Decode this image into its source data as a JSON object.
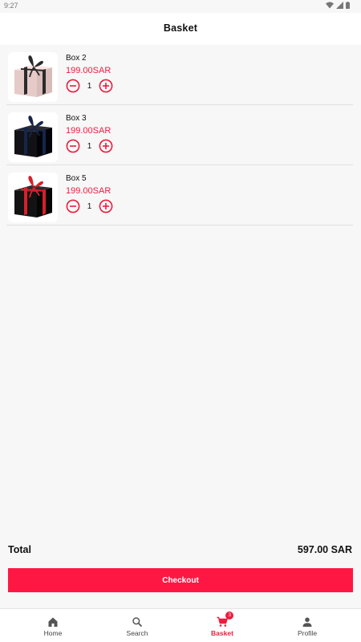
{
  "status_bar": {
    "time": "9:27"
  },
  "header": {
    "title": "Basket"
  },
  "items": [
    {
      "name": "Box 2",
      "price": "199.00SAR",
      "quantity": "1",
      "box_color": "#f1d6d4",
      "ribbon_color": "#2a2a2a"
    },
    {
      "name": "Box 3",
      "price": "199.00SAR",
      "quantity": "1",
      "box_color": "#1e1e22",
      "ribbon_color": "#16254a"
    },
    {
      "name": "Box 5",
      "price": "199.00SAR",
      "quantity": "1",
      "box_color": "#1f1f1f",
      "ribbon_color": "#d8202a"
    }
  ],
  "summary": {
    "total_label": "Total",
    "total_value": "597.00 SAR"
  },
  "checkout": {
    "label": "Checkout"
  },
  "nav": {
    "items": [
      {
        "label": "Home",
        "icon": "home-icon"
      },
      {
        "label": "Search",
        "icon": "search-icon"
      },
      {
        "label": "Basket",
        "icon": "cart-icon",
        "badge": "3",
        "active": true
      },
      {
        "label": "Profile",
        "icon": "person-icon"
      }
    ]
  },
  "colors": {
    "accent": "#ee1c3f",
    "button": "#ff1744",
    "background": "#f7f7f7"
  }
}
